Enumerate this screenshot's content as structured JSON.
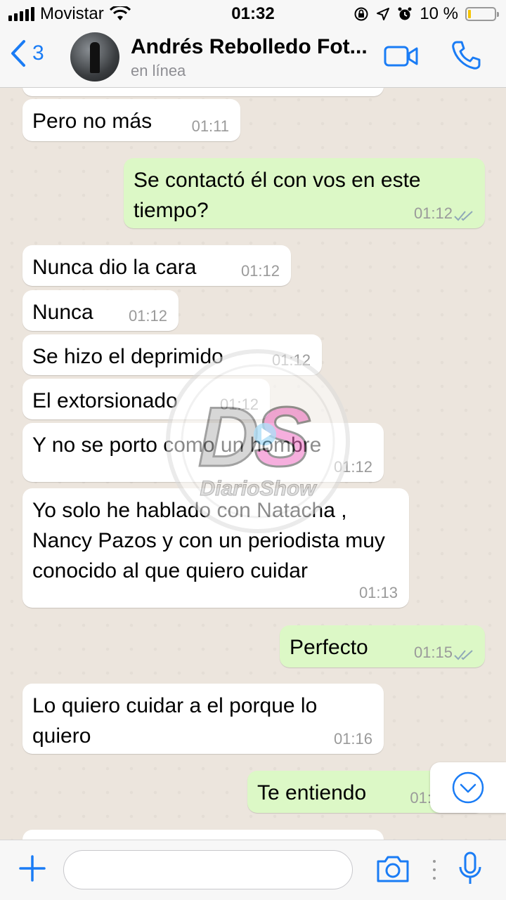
{
  "status_bar": {
    "carrier": "Movistar",
    "time": "01:32",
    "battery_percent": "10 %",
    "battery_level": 0.1
  },
  "header": {
    "back_count": "3",
    "contact_name": "Andrés Rebolledo Fot...",
    "status": "en línea"
  },
  "messages": [
    {
      "direction": "in",
      "text": "Pero no más",
      "time": "01:11"
    },
    {
      "direction": "out",
      "text": "Se contactó él con vos en este tiempo?",
      "time": "01:12",
      "read": true
    },
    {
      "direction": "in",
      "text": "Nunca dio la cara",
      "time": "01:12"
    },
    {
      "direction": "in",
      "text": "Nunca",
      "time": "01:12"
    },
    {
      "direction": "in",
      "text": "Se hizo el deprimido",
      "time": "01:12"
    },
    {
      "direction": "in",
      "text": "El extorsionado",
      "time": "01:12"
    },
    {
      "direction": "in",
      "text": "Y no se porto como un hombre",
      "time": "01:12"
    },
    {
      "direction": "in",
      "text": "Yo solo he hablado con Natacha , Nancy Pazos y con un periodista muy conocido al que quiero cuidar",
      "time": "01:13"
    },
    {
      "direction": "out",
      "text": "Perfecto",
      "time": "01:15",
      "read": true
    },
    {
      "direction": "in",
      "text": "Lo quiero cuidar a el porque lo quiero",
      "time": "01:16"
    },
    {
      "direction": "out",
      "text": "Te entiendo",
      "time": "01:"
    }
  ],
  "watermark": {
    "logo_text": "DS",
    "brand": "DiarioShow"
  },
  "input_bar": {
    "placeholder": ""
  },
  "colors": {
    "accent": "#1a7cf5",
    "outgoing_bubble": "#dcf8c6",
    "incoming_bubble": "#ffffff",
    "chat_background": "#ece5dd",
    "read_ticks": "#8fa8b8"
  },
  "icons": [
    "signal-icon",
    "wifi-icon",
    "lock-rotation-icon",
    "location-icon",
    "alarm-icon",
    "battery-icon",
    "back-chevron-icon",
    "video-call-icon",
    "phone-icon",
    "scroll-down-icon",
    "plus-icon",
    "camera-icon",
    "mic-icon"
  ]
}
